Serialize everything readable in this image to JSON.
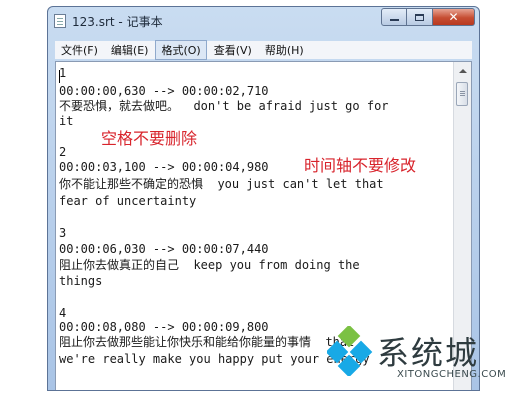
{
  "window": {
    "title": "123.srt - 记事本",
    "icon": "notepad-icon"
  },
  "menu": {
    "items": [
      {
        "label": "文件(F)",
        "active": false
      },
      {
        "label": "编辑(E)",
        "active": false
      },
      {
        "label": "格式(O)",
        "active": true
      },
      {
        "label": "查看(V)",
        "active": false
      },
      {
        "label": "帮助(H)",
        "active": false
      }
    ]
  },
  "document": {
    "lines": [
      "1",
      "00:00:00,630 --> 00:00:02,710",
      "不要恐惧，就去做吧。  don't be afraid just go for",
      "it",
      "",
      "2",
      "00:00:03,100 --> 00:00:04,980",
      "你不能让那些不确定的恐惧  you just can't let that",
      "fear of uncertainty",
      "",
      "3",
      "00:00:06,030 --> 00:00:07,440",
      "阻止你去做真正的自己  keep you from doing the",
      "things",
      "",
      "4",
      "00:00:08,080 --> 00:00:09,800",
      "阻止你去做那些能让你快乐和能给你能量的事情  that",
      "we're really make you happy put your energy"
    ]
  },
  "annotations": {
    "spaces_note": "空格不要删除",
    "timeline_note": "时间轴不要修改",
    "color": "#d8242c"
  },
  "watermark": {
    "brand": "系统城",
    "url": "XITONGCHENG.COM",
    "logo_colors": [
      "#18a9e6",
      "#7bc143"
    ]
  }
}
